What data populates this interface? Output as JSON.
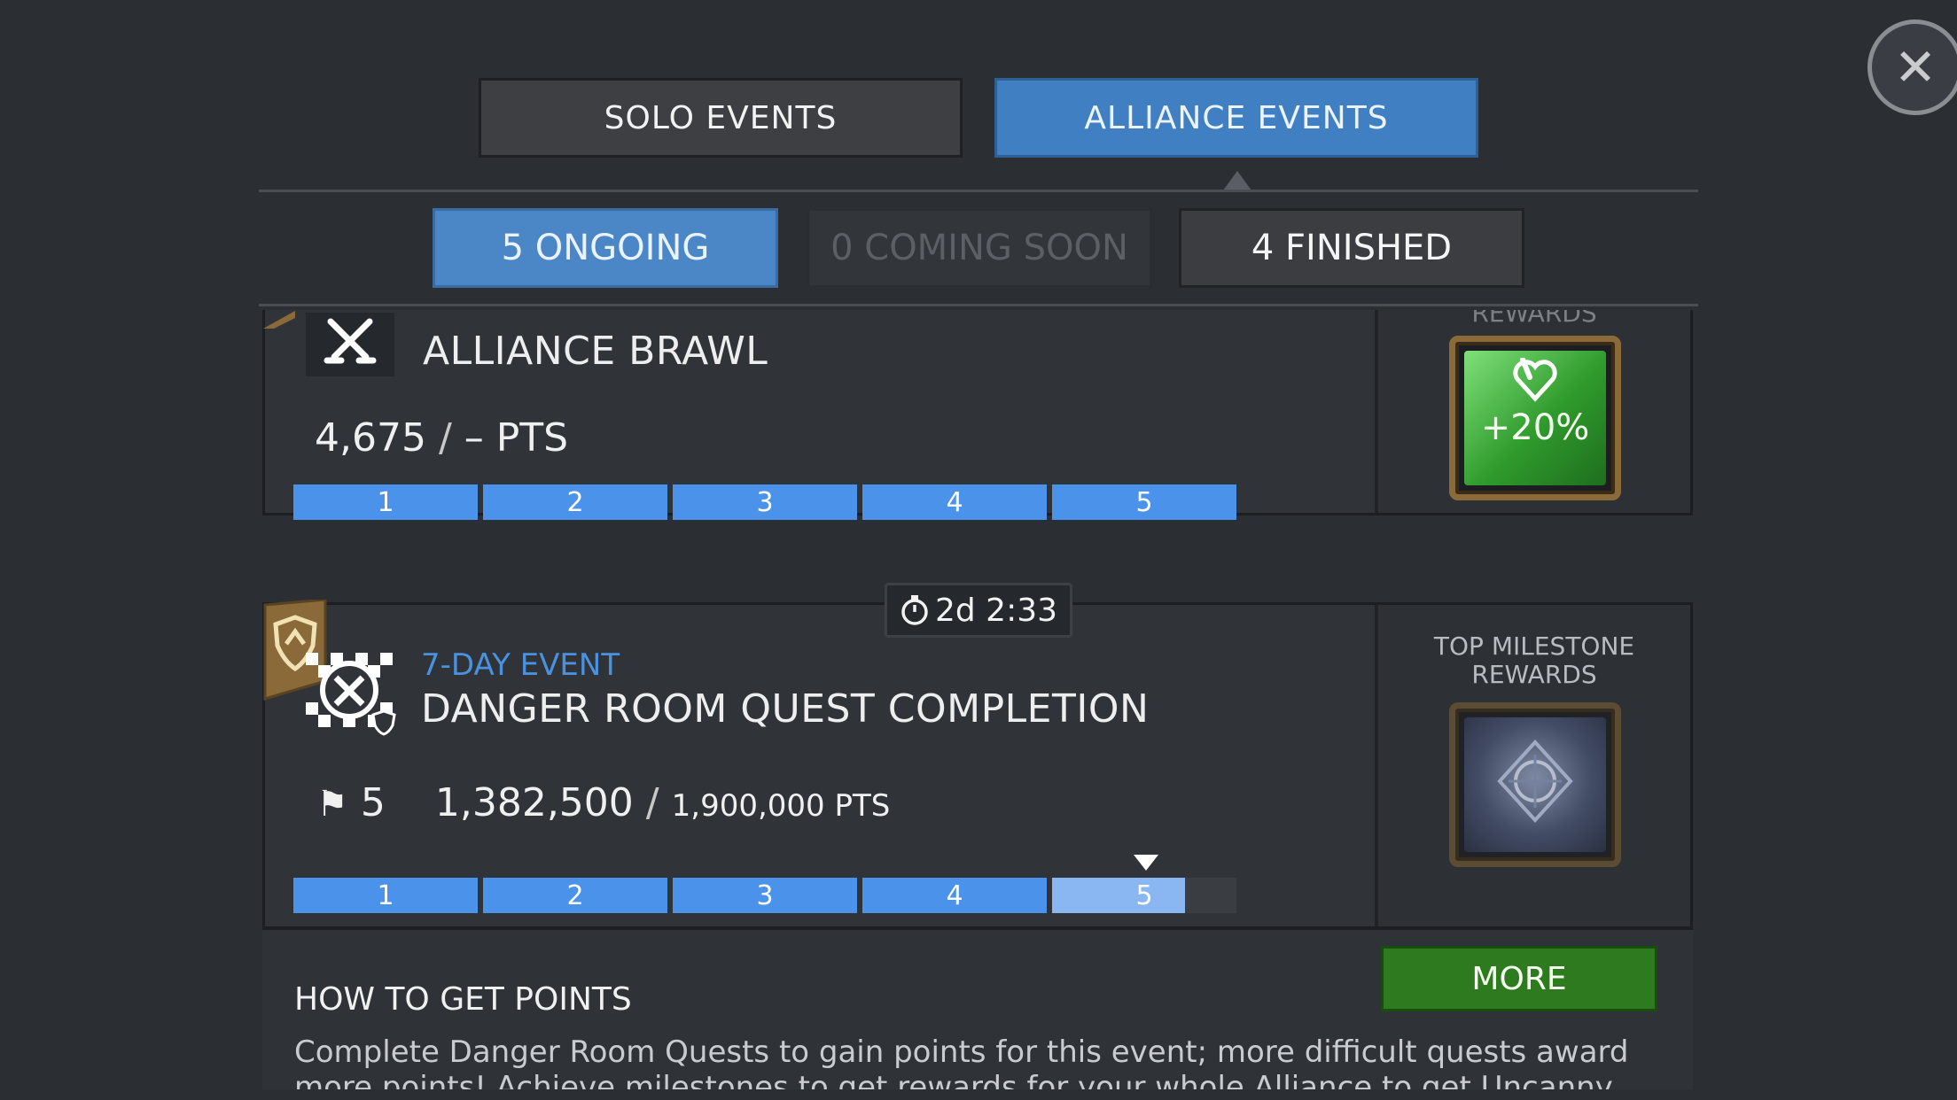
{
  "close": {
    "icon": "close-icon"
  },
  "tabs": {
    "solo": "SOLO EVENTS",
    "alliance": "ALLIANCE EVENTS",
    "active": "alliance"
  },
  "subtabs": {
    "ongoing": "5 ONGOING",
    "coming_soon": "0 COMING SOON",
    "finished": "4 FINISHED",
    "active": "ongoing"
  },
  "events": [
    {
      "title": "ALLIANCE BRAWL",
      "points": "4,675",
      "goal": "– PTS",
      "milestones": [
        "1",
        "2",
        "3",
        "4",
        "5"
      ],
      "progress_fraction": 1.0,
      "side_label": "REWARDS",
      "reward_text": "+20%",
      "icon": "crossed-swords-icon"
    },
    {
      "timer": "2d 2:33",
      "subtitle": "7-DAY EVENT",
      "title": "DANGER ROOM QUEST COMPLETION",
      "milestone_reached": "5",
      "points": "1,382,500",
      "goal": "1,900,000 PTS",
      "milestones": [
        "1",
        "2",
        "3",
        "4",
        "5"
      ],
      "last_segment_fill": 0.72,
      "side_label_line1": "TOP MILESTONE",
      "side_label_line2": "REWARDS",
      "icon": "danger-room-icon"
    }
  ],
  "how_to": {
    "title": "HOW TO GET POINTS",
    "more": "MORE",
    "description": "Complete Danger Room Quests to gain points for this event; more difficult quests award more points! Achieve milestones to get rewards for your whole Alliance to get Uncanny Passes for"
  },
  "colors": {
    "accent": "#3f7fc2",
    "bar": "#4a92ea",
    "more": "#2e7a1e",
    "subtitle": "#4a92e0"
  }
}
